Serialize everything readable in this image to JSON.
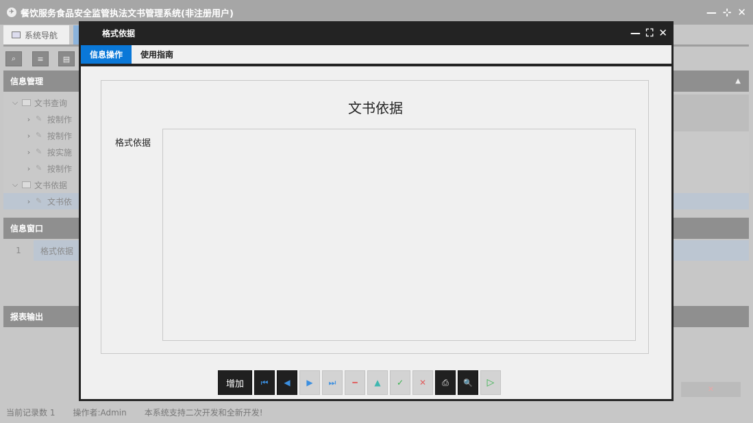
{
  "app": {
    "title": "餐饮服务食品安全监管执法文书管理系统(非注册用户)",
    "logo_glyph": "✈",
    "window_controls": [
      "—",
      "⊹",
      "✕"
    ]
  },
  "tabs": [
    {
      "label": "系统导航"
    }
  ],
  "toolbar": {
    "buttons": [
      "search-icon",
      "edit-icon",
      "document-icon"
    ]
  },
  "info_manage": {
    "title": "信息管理",
    "tree": [
      {
        "label": "文书查询",
        "level": 0,
        "expanded": true
      },
      {
        "label": "按制作",
        "level": 1
      },
      {
        "label": "按制作",
        "level": 1
      },
      {
        "label": "按实施",
        "level": 1
      },
      {
        "label": "按制作",
        "level": 1
      },
      {
        "label": "文书依据",
        "level": 0,
        "expanded": true
      },
      {
        "label": "文书依",
        "level": 1,
        "selected": true
      }
    ]
  },
  "info_window": {
    "title": "信息窗口",
    "rows": [
      {
        "no": "1",
        "name": "格式依据"
      }
    ]
  },
  "report": {
    "title": "报表输出"
  },
  "status": {
    "records": "当前记录数 1",
    "operator": "操作者:Admin",
    "note": "本系统支持二次开发和全新开发!"
  },
  "modal": {
    "title": "格式依据",
    "controls": [
      "—",
      "⛶",
      "✕"
    ],
    "tabs": [
      {
        "label": "信息操作",
        "active": true
      },
      {
        "label": "使用指南",
        "active": false
      }
    ],
    "form_title": "文书依据",
    "field_label": "格式依据",
    "field_value": "",
    "buttons": {
      "add": "增加",
      "first": "⏮",
      "prev": "◀",
      "next": "▶",
      "last": "⏭",
      "delete": "━",
      "up": "▲",
      "confirm": "✓",
      "cancel": "✕",
      "print": "⎙",
      "preview": "🔍",
      "run": "▷"
    }
  }
}
